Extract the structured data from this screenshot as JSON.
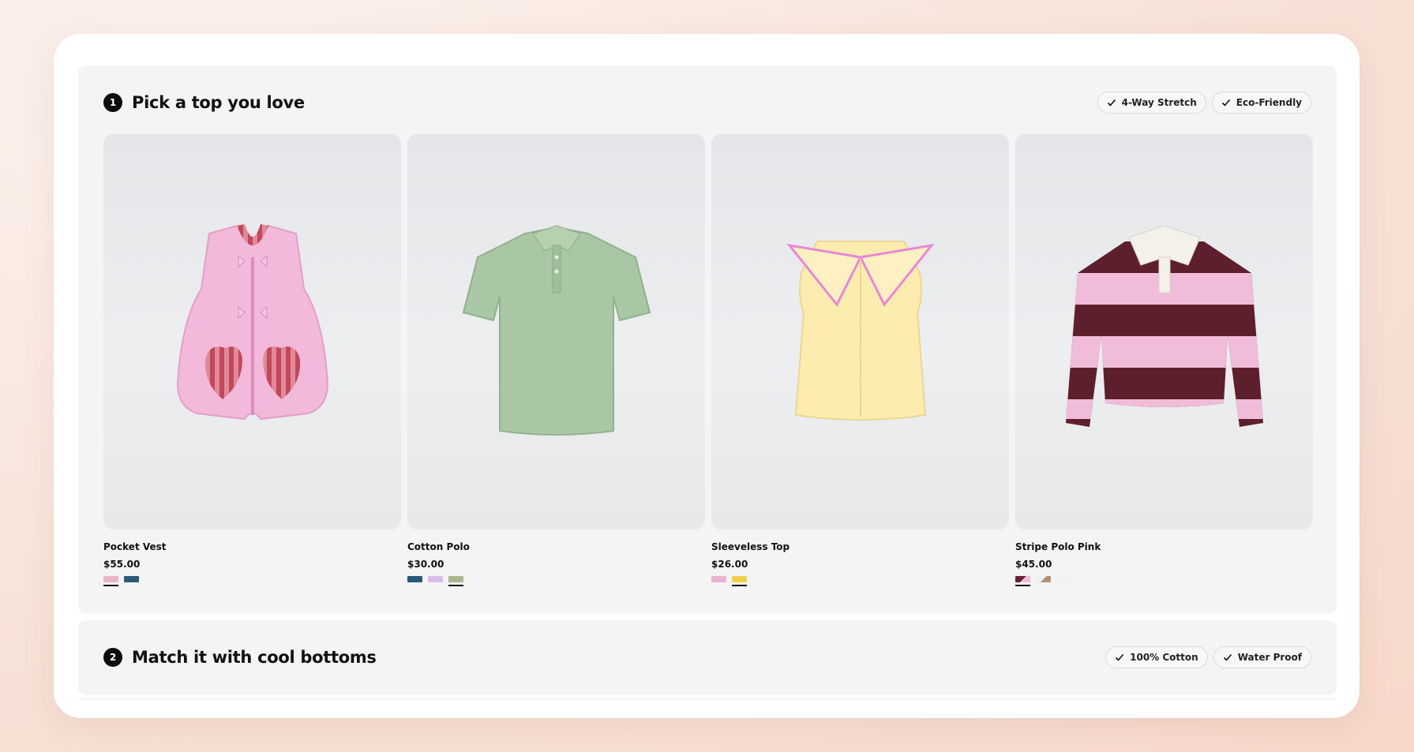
{
  "step1": {
    "number": "1",
    "title": "Pick a top you love",
    "tags": [
      "4-Way Stretch",
      "Eco-Friendly"
    ],
    "products": [
      {
        "name": "Pocket Vest",
        "price": "$55.00",
        "image_icon": "pink-vest-image",
        "swatches": [
          {
            "color": "#e8b4cc",
            "selected": true
          },
          {
            "color": "#2c5a7a",
            "selected": false
          }
        ]
      },
      {
        "name": "Cotton Polo",
        "price": "$30.00",
        "image_icon": "green-polo-image",
        "swatches": [
          {
            "color": "#255a7c",
            "selected": false
          },
          {
            "color": "#d9bde6",
            "selected": false
          },
          {
            "color": "#a9b78e",
            "selected": true
          }
        ]
      },
      {
        "name": "Sleeveless Top",
        "price": "$26.00",
        "image_icon": "yellow-top-image",
        "swatches": [
          {
            "color": "#e9b4cf",
            "selected": false
          },
          {
            "color": "#f3cf4f",
            "selected": true
          }
        ]
      },
      {
        "name": "Stripe Polo Pink",
        "price": "$45.00",
        "image_icon": "striped-sweater-image",
        "swatches": [
          {
            "color": "#6a1f33",
            "selected": true
          },
          {
            "color": "#b38f77",
            "selected": false
          },
          {
            "color": "#f1f1f1",
            "selected": false
          }
        ]
      }
    ]
  },
  "step2": {
    "number": "2",
    "title": "Match it with cool bottoms",
    "tags": [
      "100% Cotton",
      "Water Proof"
    ]
  }
}
